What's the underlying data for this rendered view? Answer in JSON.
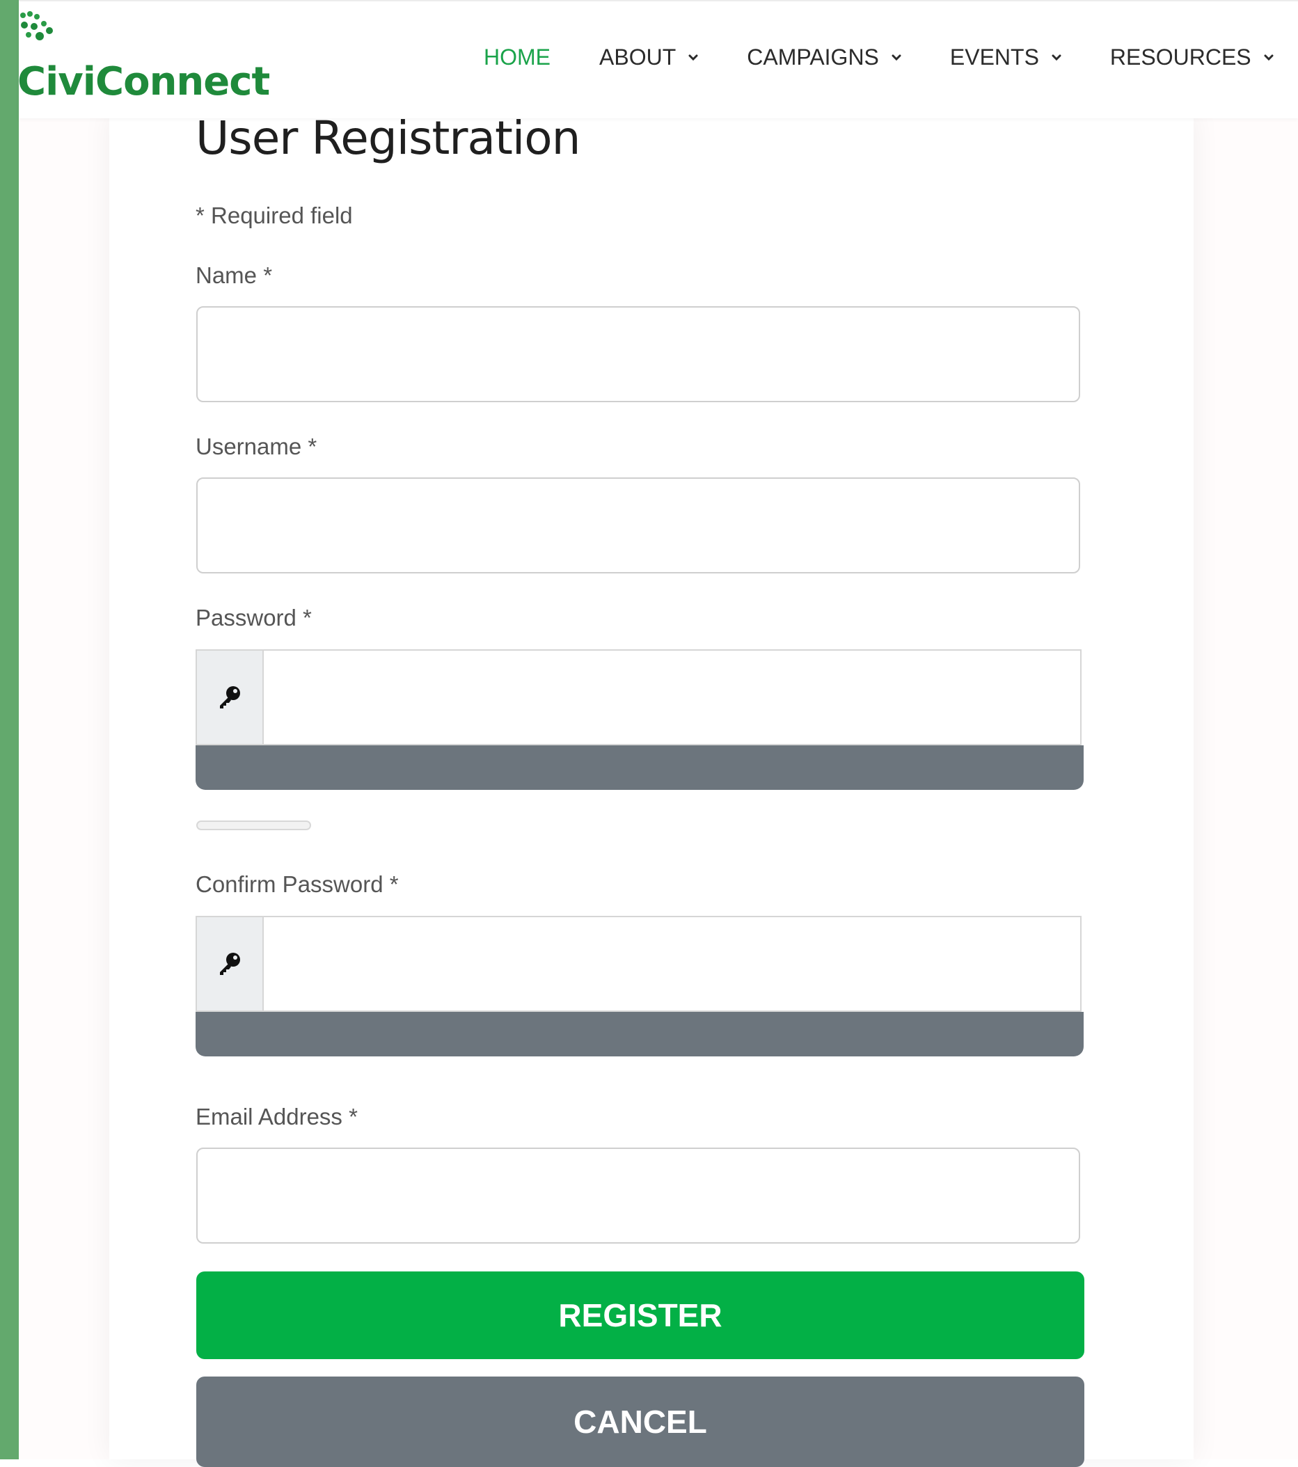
{
  "brand": {
    "name": "CiviConnect",
    "accent_color": "#1aa34a"
  },
  "nav": {
    "items": [
      {
        "label": "HOME",
        "active": true,
        "has_dropdown": false
      },
      {
        "label": "ABOUT",
        "active": false,
        "has_dropdown": true
      },
      {
        "label": "CAMPAIGNS",
        "active": false,
        "has_dropdown": true
      },
      {
        "label": "EVENTS",
        "active": false,
        "has_dropdown": true
      },
      {
        "label": "RESOURCES",
        "active": false,
        "has_dropdown": true
      }
    ]
  },
  "form": {
    "title": "User Registration",
    "required_note": "* Required field",
    "fields": {
      "name": {
        "label": "Name *",
        "value": ""
      },
      "username": {
        "label": "Username *",
        "value": ""
      },
      "password": {
        "label": "Password *",
        "value": "",
        "icon": "key-icon"
      },
      "confirm_password": {
        "label": "Confirm Password *",
        "value": "",
        "icon": "key-icon"
      },
      "email": {
        "label": "Email Address *",
        "value": ""
      }
    },
    "register_label": "REGISTER",
    "cancel_label": "CANCEL",
    "register_color": "#03b046",
    "cancel_color": "#6c757d"
  }
}
